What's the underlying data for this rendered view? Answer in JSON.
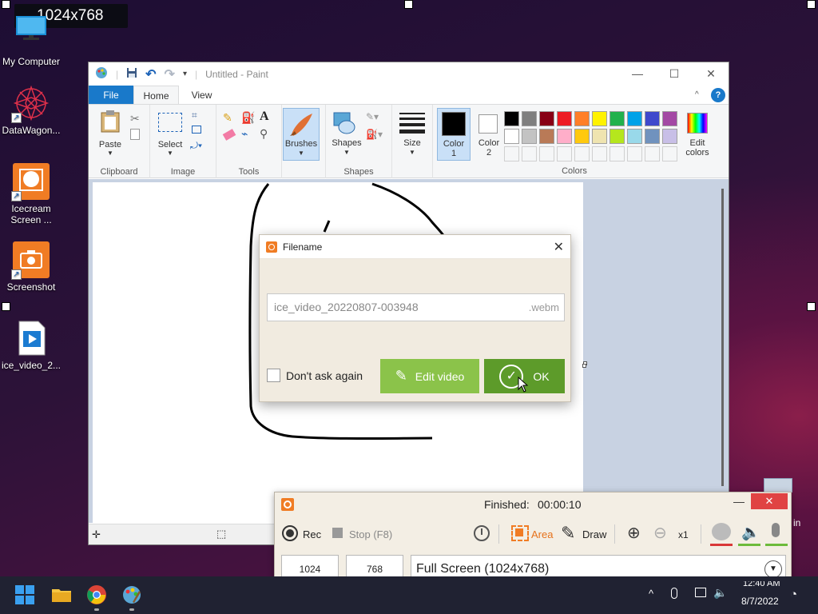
{
  "resolution_label": "1024x768",
  "desktop": {
    "icons": [
      {
        "label": "My Computer",
        "icon": "monitor-icon"
      },
      {
        "label": "DataWagon...",
        "icon": "datawagon-icon"
      },
      {
        "label": "Icecream Screen ...",
        "icon": "icecream-icon"
      },
      {
        "label": "Screenshot",
        "icon": "camera-icon"
      },
      {
        "label": "ice_video_2...",
        "icon": "video-file-icon"
      }
    ],
    "recycle_bin_partial": "in"
  },
  "paint": {
    "title": "Untitled - Paint",
    "tabs": {
      "file": "File",
      "home": "Home",
      "view": "View"
    },
    "ribbon": {
      "clipboard": {
        "paste": "Paste",
        "group": "Clipboard"
      },
      "image": {
        "select": "Select",
        "group": "Image"
      },
      "tools": {
        "group": "Tools"
      },
      "brushes": {
        "label": "Brushes"
      },
      "shapes": {
        "label": "Shapes",
        "group": "Shapes"
      },
      "size": {
        "label": "Size"
      },
      "color1": {
        "label": "Color",
        "num": "1"
      },
      "color2": {
        "label": "Color",
        "num": "2"
      },
      "edit_colors": {
        "line1": "Edit",
        "line2": "colors"
      },
      "colors_group": "Colors"
    },
    "palette_row1": [
      "#000000",
      "#7f7f7f",
      "#880015",
      "#ed1c24",
      "#ff7f27",
      "#fff200",
      "#22b14c",
      "#00a2e8",
      "#3f48cc",
      "#a349a4"
    ],
    "palette_row2": [
      "#ffffff",
      "#c3c3c3",
      "#b97a57",
      "#ffaec9",
      "#ffc90e",
      "#efe4b0",
      "#b5e61d",
      "#99d9ea",
      "#7092be",
      "#c8bfe7"
    ],
    "color1_value": "#000000",
    "color2_value": "#ffffff"
  },
  "dialog": {
    "title": "Filename",
    "filename": "ice_video_20220807-003948",
    "extension": ".webm",
    "dont_ask_label": "Don't ask again",
    "dont_ask_checked": false,
    "edit_button": "Edit video",
    "ok_button": "OK"
  },
  "recorder": {
    "status_label": "Finished:",
    "duration": "00:00:10",
    "rec_label": "Rec",
    "stop_label": "Stop (F8)",
    "area_label": "Area",
    "draw_label": "Draw",
    "zoom_level": "x1",
    "width": "1024",
    "height": "768",
    "mode": "Full Screen (1024x768)"
  },
  "taskbar": {
    "time_partial": "12:40 AM",
    "date": "8/7/2022"
  }
}
